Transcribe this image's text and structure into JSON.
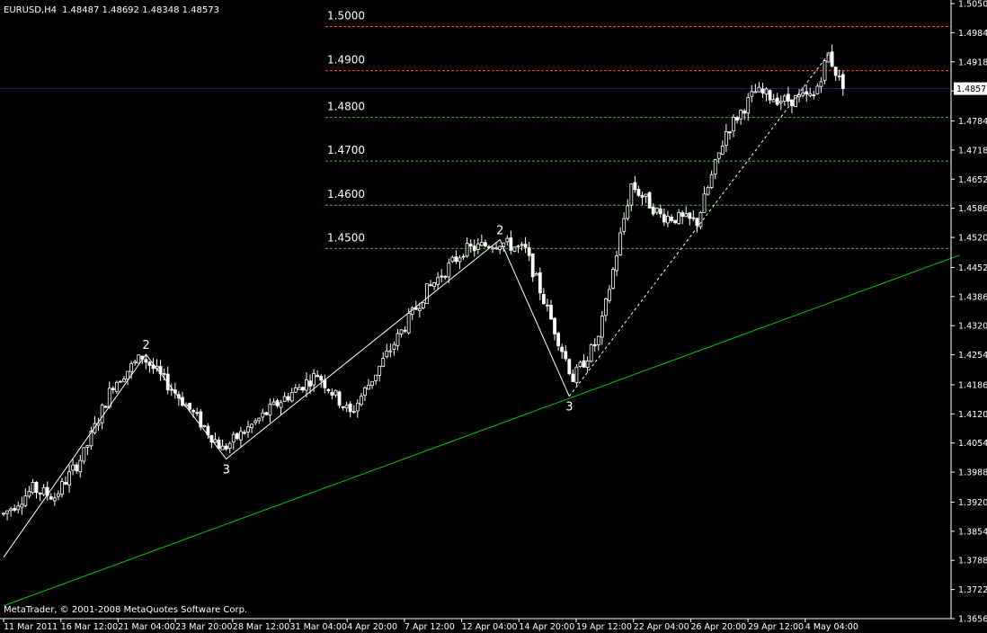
{
  "header": {
    "symbol": "EURUSD,H4",
    "quote": "1.48487 1.48692 1.48348 1.48573"
  },
  "copyright": "MetaTrader, © 2001-2008 MetaQuotes Software Corp.",
  "chart_data": {
    "type": "candlestick",
    "symbol": "EURUSD",
    "timeframe": "H4",
    "ylim": [
      1.3656,
      1.505
    ],
    "y_ticks": [
      "1.50500",
      "1.49840",
      "1.49180",
      "1.48520",
      "1.47840",
      "1.47180",
      "1.46520",
      "1.45860",
      "1.45200",
      "1.44520",
      "1.43860",
      "1.43200",
      "1.42540",
      "1.41860",
      "1.41200",
      "1.40540",
      "1.39880",
      "1.39200",
      "1.38540",
      "1.37880",
      "1.37220",
      "1.36560"
    ],
    "x_ticks": [
      "11 Mar 2011",
      "16 Mar 12:00",
      "21 Mar 04:00",
      "23 Mar 20:00",
      "28 Mar 12:00",
      "31 Mar 04:00",
      "4 Apr 20:00",
      "7 Apr 12:00",
      "12 Apr 04:00",
      "14 Apr 20:00",
      "19 Apr 12:00",
      "22 Apr 04:00",
      "26 Apr 20:00",
      "29 Apr 12:00",
      "4 May 04:00"
    ],
    "current_price": "1.48573",
    "bar_count": 230,
    "anchors": [
      [
        0,
        1.3893
      ],
      [
        8,
        1.395
      ],
      [
        14,
        1.3932
      ],
      [
        22,
        1.403
      ],
      [
        30,
        1.4188
      ],
      [
        38,
        1.425
      ],
      [
        48,
        1.416
      ],
      [
        60,
        1.404
      ],
      [
        66,
        1.408
      ],
      [
        76,
        1.415
      ],
      [
        86,
        1.421
      ],
      [
        95,
        1.412
      ],
      [
        104,
        1.424
      ],
      [
        116,
        1.44
      ],
      [
        126,
        1.449
      ],
      [
        136,
        1.451
      ],
      [
        143,
        1.449
      ],
      [
        156,
        1.42
      ],
      [
        163,
        1.429
      ],
      [
        172,
        1.464
      ],
      [
        180,
        1.457
      ],
      [
        190,
        1.4555
      ],
      [
        198,
        1.476
      ],
      [
        206,
        1.485
      ],
      [
        214,
        1.483
      ],
      [
        222,
        1.484
      ],
      [
        226,
        1.4935
      ],
      [
        230,
        1.4857
      ]
    ],
    "wave_labels": [
      {
        "text": "2",
        "bar": 39,
        "price": 1.4255,
        "pos": "above"
      },
      {
        "text": "3",
        "bar": 61,
        "price": 1.4018,
        "pos": "below"
      },
      {
        "text": "2",
        "bar": 136,
        "price": 1.4515,
        "pos": "above"
      },
      {
        "text": "3",
        "bar": 155,
        "price": 1.416,
        "pos": "below"
      }
    ],
    "zigzag": [
      [
        0,
        1.3795
      ],
      [
        39,
        1.4255
      ],
      [
        61,
        1.4018
      ],
      [
        136,
        1.4515
      ],
      [
        155,
        1.416
      ]
    ],
    "dashed_trend": [
      [
        155,
        1.416
      ],
      [
        226,
        1.4935
      ]
    ],
    "trendline": [
      [
        0,
        1.3685
      ],
      [
        262,
        1.448
      ]
    ],
    "levels": [
      {
        "label": "1.5000",
        "price": 1.4998,
        "color": "#ff4040"
      },
      {
        "label": "1.4900",
        "price": 1.4898,
        "color": "#ff4040"
      },
      {
        "label": "1.4800",
        "price": 1.4792,
        "color": "#3cb043"
      },
      {
        "label": "1.4700",
        "price": 1.4693,
        "color": "#3cb043"
      },
      {
        "label": "1.4600",
        "price": 1.4593,
        "color": "#3cb043"
      },
      {
        "label": "1.4500",
        "price": 1.4495,
        "color": "#3cb043"
      }
    ],
    "colors": {
      "background": "#000000",
      "axis": "#ffffff",
      "candle": "#ffffff",
      "bear_body": "#ffffff",
      "zigzag": "#ffffff",
      "trendline": "#00c800",
      "bid_line": "#1e1e5a"
    }
  }
}
